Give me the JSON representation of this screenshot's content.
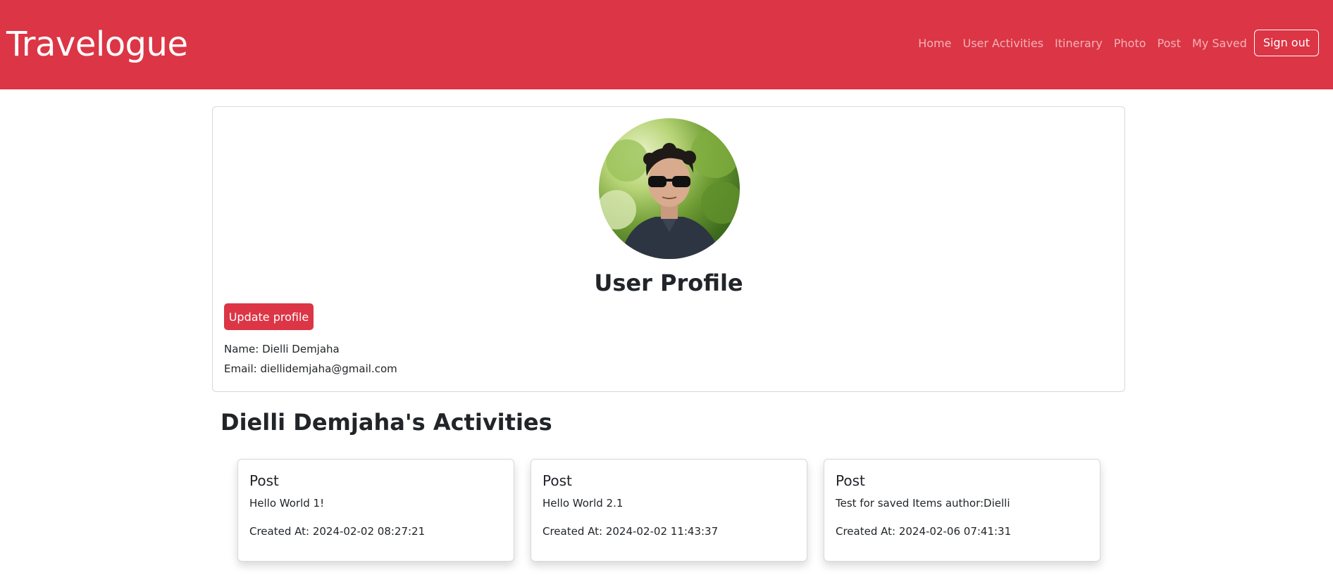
{
  "header": {
    "brand": "Travelogue",
    "nav": [
      "Home",
      "User Activities",
      "Itinerary",
      "Photo",
      "Post",
      "My Saved"
    ],
    "signout_label": "Sign out",
    "bg_color": "#dc3545"
  },
  "profile": {
    "title": "User Profile",
    "update_label": "Update profile",
    "name_line": "Name: Dielli Demjaha",
    "email_line": "Email: diellidemjaha@gmail.com",
    "avatar_icon": "user-photo"
  },
  "activities": {
    "title": "Dielli Demjaha's Activities",
    "items": [
      {
        "type": "Post",
        "content": "Hello World 1!",
        "created": "Created At: 2024-02-02 08:27:21"
      },
      {
        "type": "Post",
        "content": "Hello World 2.1",
        "created": "Created At: 2024-02-02 11:43:37"
      },
      {
        "type": "Post",
        "content": "Test for saved Items author:Dielli",
        "created": "Created At: 2024-02-06 07:41:31"
      }
    ]
  }
}
